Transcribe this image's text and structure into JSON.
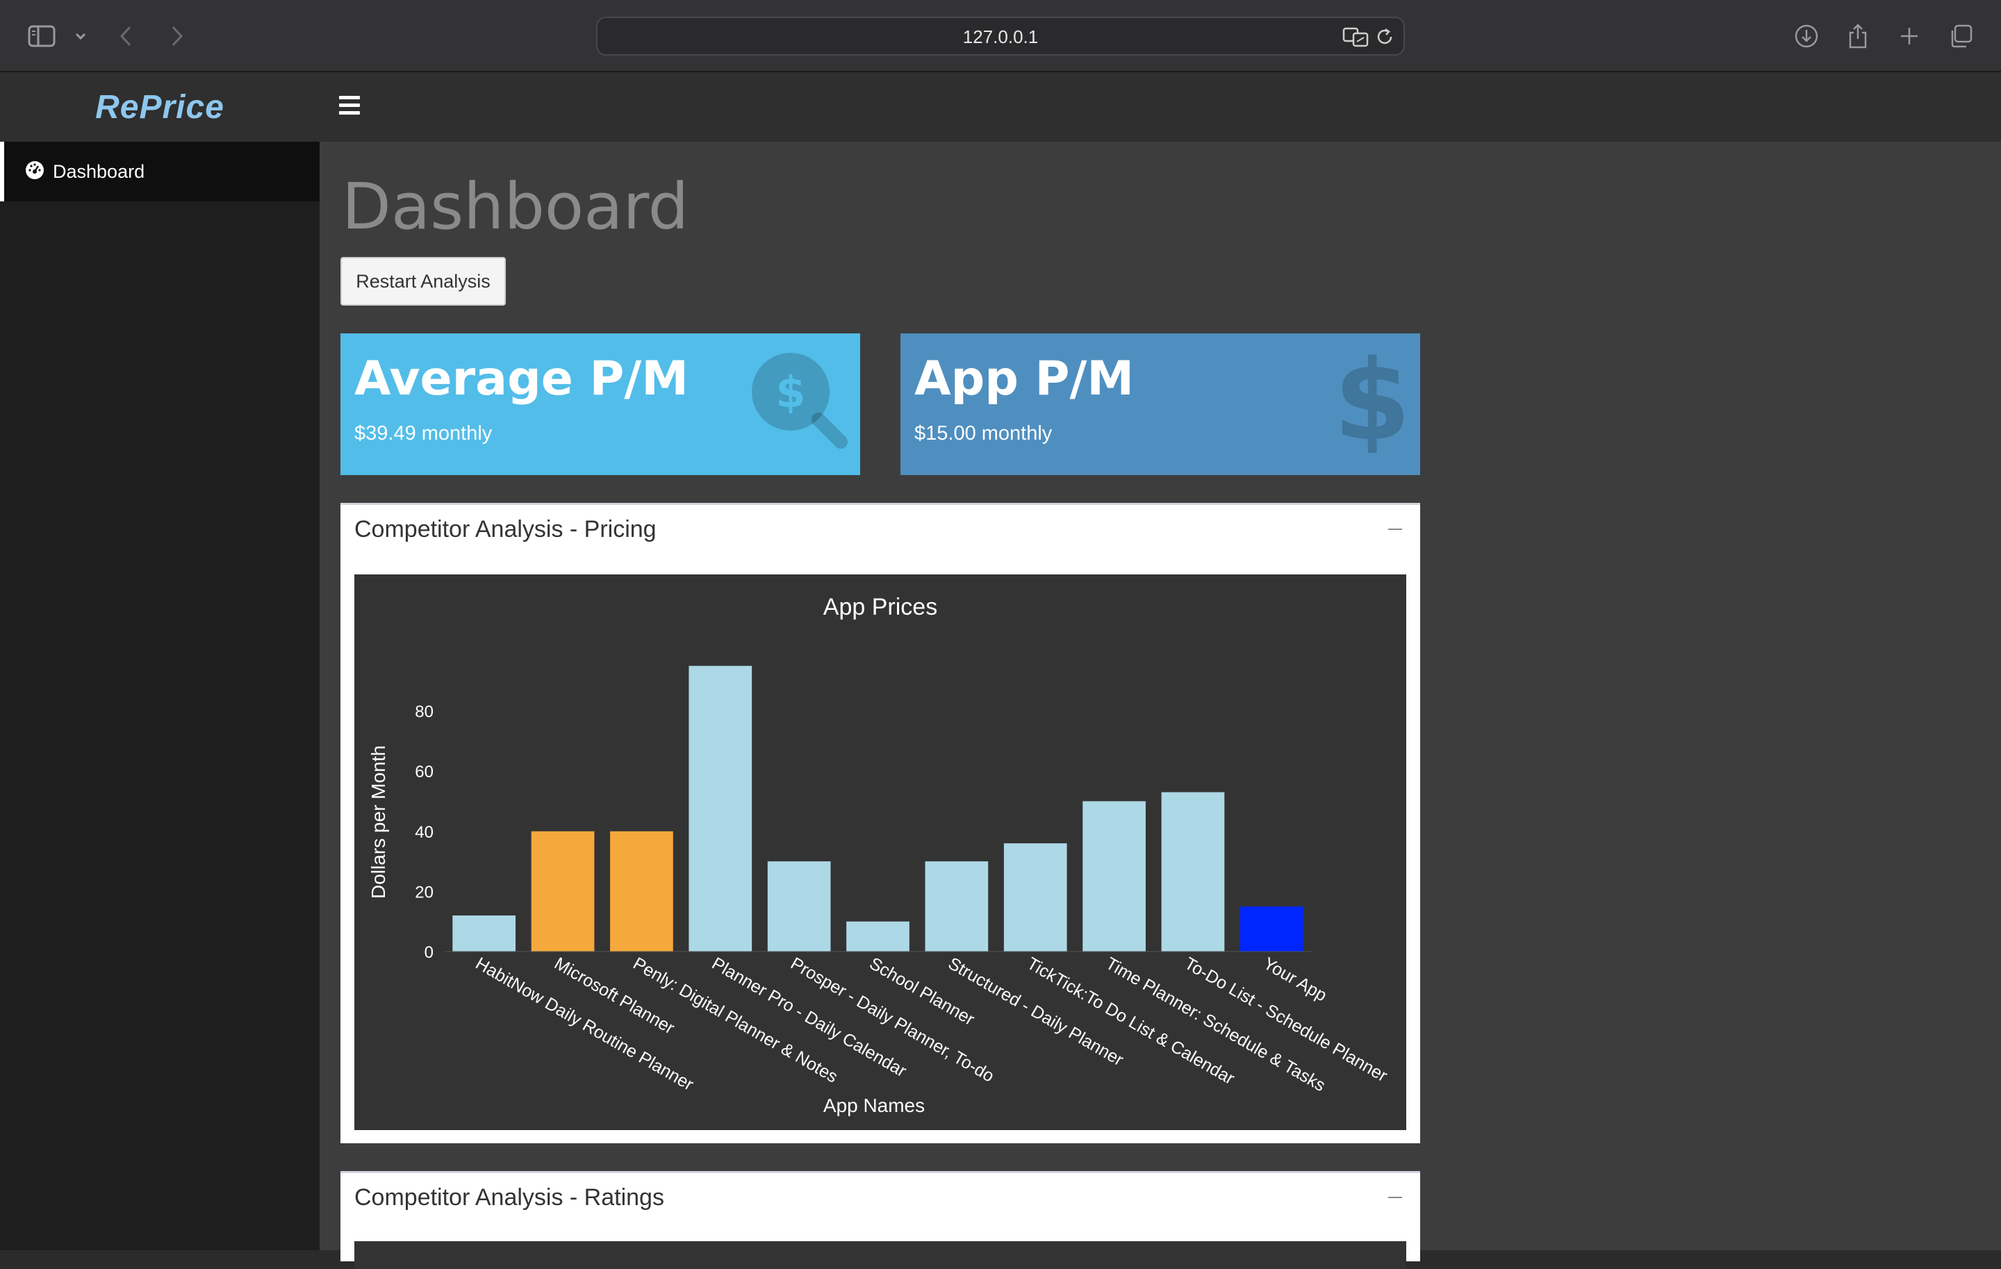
{
  "browser": {
    "url": "127.0.0.1"
  },
  "app": {
    "logo": "RePrice"
  },
  "sidebar": {
    "items": [
      {
        "label": "Dashboard",
        "icon": "dashboard-icon"
      }
    ]
  },
  "page": {
    "title": "Dashboard",
    "restart_label": "Restart Analysis"
  },
  "value_boxes": [
    {
      "title": "Average P/M",
      "subtitle": "$39.49 monthly",
      "color": "#52bde9",
      "icon": "search-dollar-icon"
    },
    {
      "title": "App P/M",
      "subtitle": "$15.00 monthly",
      "color": "#4f8fbf",
      "icon": "dollar-icon"
    }
  ],
  "boxes": [
    {
      "title": "Competitor Analysis - Pricing"
    },
    {
      "title": "Competitor Analysis - Ratings"
    }
  ],
  "chart_data": {
    "type": "bar",
    "title": "App Prices",
    "xlabel": "App Names",
    "ylabel": "Dollars per Month",
    "ylim": [
      0,
      100
    ],
    "yticks": [
      0,
      20,
      40,
      60,
      80
    ],
    "grid": false,
    "categories": [
      "HabitNow Daily Routine Planner",
      "Microsoft Planner",
      "Penly: Digital Planner & Notes",
      "Planner Pro - Daily Calendar",
      "Prosper - Daily Planner, To-do",
      "School Planner",
      "Structured - Daily Planner",
      "TickTick:To Do List & Calendar",
      "Time Planner: Schedule & Tasks",
      "To-Do List - Schedule Planner",
      "Your App"
    ],
    "values": [
      12,
      39.99,
      39.99,
      95,
      30,
      10,
      30,
      36,
      50,
      53,
      15
    ],
    "colors": [
      "#add8e6",
      "#f5a83b",
      "#f5a83b",
      "#add8e6",
      "#add8e6",
      "#add8e6",
      "#add8e6",
      "#add8e6",
      "#add8e6",
      "#add8e6",
      "#0026ff"
    ]
  }
}
